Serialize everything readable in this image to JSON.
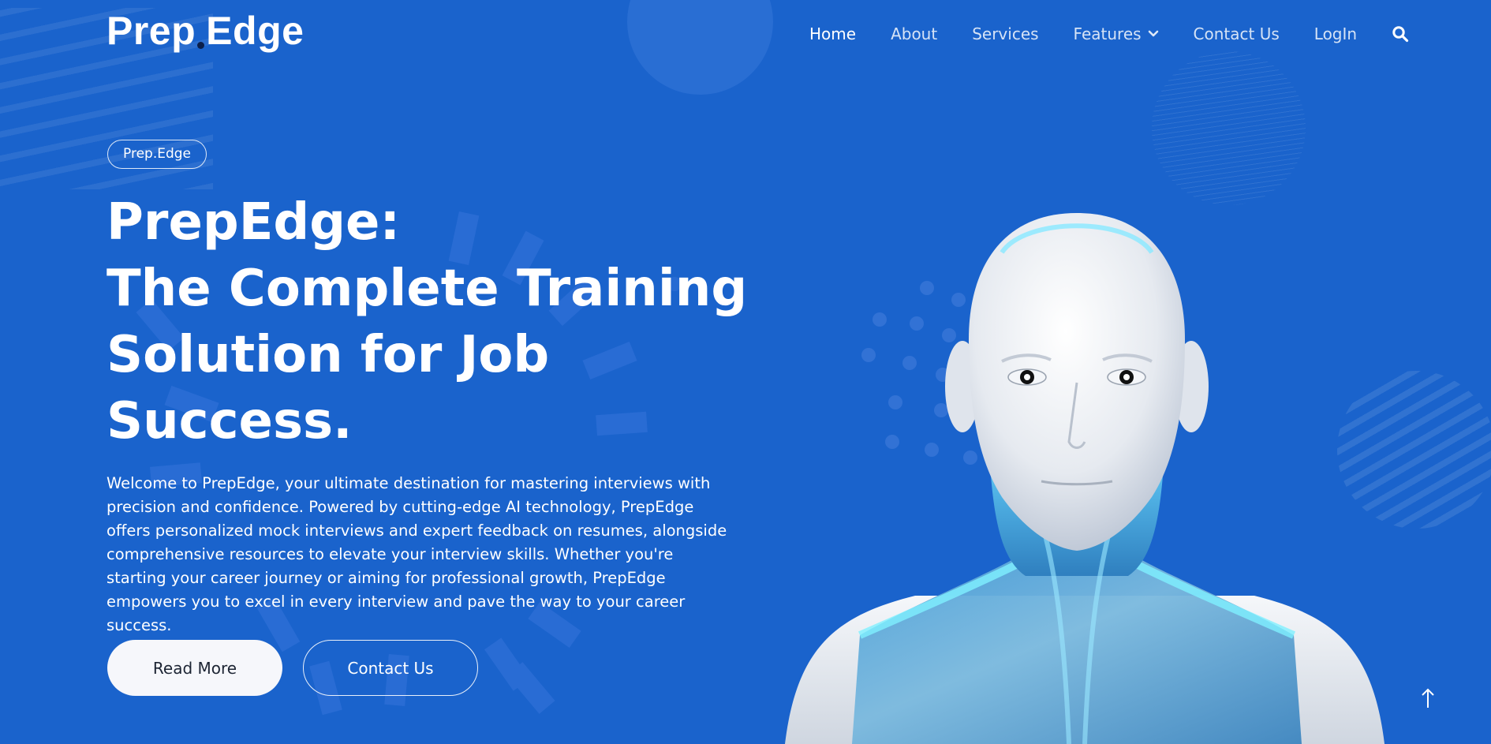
{
  "brand": {
    "logo_left": "Prep",
    "logo_right": "Edge"
  },
  "nav": {
    "items": [
      {
        "label": "Home",
        "active": true
      },
      {
        "label": "About"
      },
      {
        "label": "Services"
      },
      {
        "label": "Features",
        "has_dropdown": true
      },
      {
        "label": "Contact Us"
      },
      {
        "label": "LogIn"
      }
    ],
    "search_icon": "search-icon"
  },
  "hero": {
    "badge": "Prep.Edge",
    "headline_lines": [
      "PrepEdge:",
      "The Complete Training",
      "Solution for Job",
      "Success."
    ],
    "intro": "Welcome to PrepEdge, your ultimate destination for mastering interviews with precision and confidence. Powered by cutting-edge AI technology, PrepEdge offers personalized mock interviews and expert feedback on resumes, alongside comprehensive resources to elevate your interview skills. Whether you're starting your career journey or aiming for professional growth, PrepEdge empowers you to excel in every interview and pave the way to your career success.",
    "buttons": {
      "read_more": "Read More",
      "contact": "Contact Us"
    }
  },
  "back_to_top_icon": "arrow-up-icon",
  "colors": {
    "background": "#1a63cc",
    "text": "#ffffff",
    "button_light": "#f6f7fb"
  }
}
